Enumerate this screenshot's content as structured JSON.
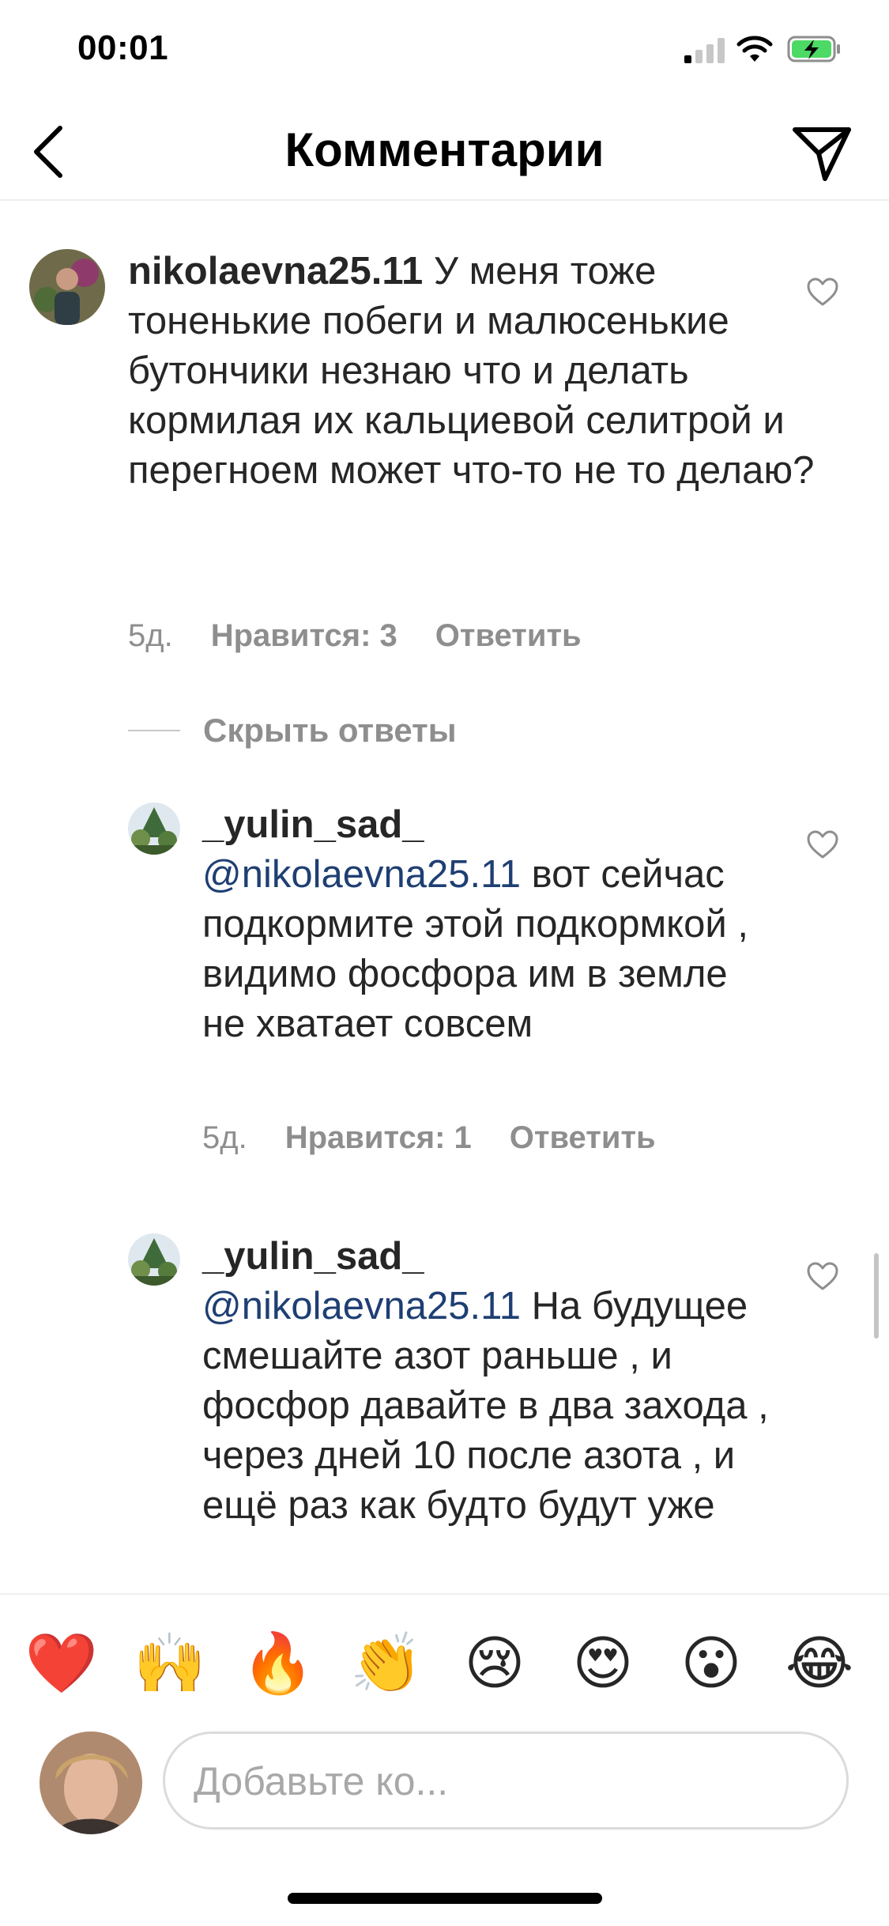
{
  "status_bar": {
    "time": "00:01"
  },
  "header": {
    "title": "Комментарии"
  },
  "comments": [
    {
      "username": "nikolaevna25.11",
      "text": "У меня тоже тоненькие побеги и малюсенькие бутончики незнаю что и делать кормилая их кальциевой селитрой и перегноем может что-то не то делаю?",
      "time": "5д.",
      "likes": "Нравится: 3",
      "reply": "Ответить"
    }
  ],
  "hide_replies": "Скрыть ответы",
  "replies": [
    {
      "username": "_yulin_sad_",
      "mention": "@nikolaevna25.11",
      "text": " вот сейчас подкормите этой подкормкой , видимо фосфора им в земле не хватает совсем",
      "time": "5д.",
      "likes": "Нравится: 1",
      "reply": "Ответить"
    },
    {
      "username": "_yulin_sad_",
      "mention": "@nikolaevna25.11",
      "text": "  На будущее смешайте азот раньше , и фосфор давайте в два захода , через дней 10 после азота , и ещё раз как будто будут уже"
    }
  ],
  "emoji_bar": [
    "❤️",
    "🙌",
    "🔥",
    "👏",
    "😢",
    "😍",
    "😮",
    "😂"
  ],
  "composer": {
    "placeholder": "Добавьте ко..."
  },
  "colors": {
    "mention": "#1f3f73",
    "meta": "#8e8e8e",
    "text": "#262626"
  }
}
